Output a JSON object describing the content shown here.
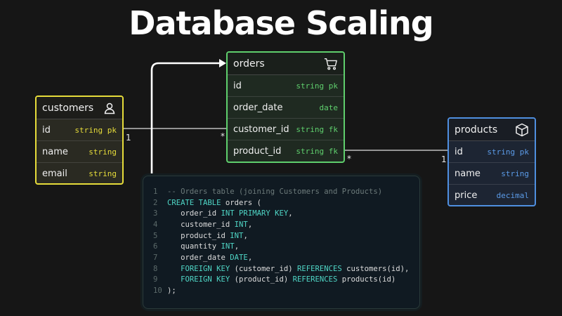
{
  "title": "Database Scaling",
  "colors": {
    "customers": "#e6dc3a",
    "orders": "#5fcf6d",
    "products": "#4f8fe0",
    "keyword": "#4fd6c6"
  },
  "tables": {
    "customers": {
      "name": "customers",
      "icon": "person-icon",
      "rows": [
        {
          "field": "id",
          "type": "string pk"
        },
        {
          "field": "name",
          "type": "string"
        },
        {
          "field": "email",
          "type": "string"
        }
      ]
    },
    "orders": {
      "name": "orders",
      "icon": "cart-icon",
      "rows": [
        {
          "field": "id",
          "type": "string pk"
        },
        {
          "field": "order_date",
          "type": "date"
        },
        {
          "field": "customer_id",
          "type": "string fk"
        },
        {
          "field": "product_id",
          "type": "string fk"
        }
      ]
    },
    "products": {
      "name": "products",
      "icon": "cube-icon",
      "rows": [
        {
          "field": "id",
          "type": "string pk"
        },
        {
          "field": "name",
          "type": "string"
        },
        {
          "field": "price",
          "type": "decimal"
        }
      ]
    }
  },
  "cardinality": {
    "customers_side": "1",
    "orders_customer_side": "*",
    "orders_product_side": "*",
    "products_side": "1"
  },
  "code": {
    "lines": [
      {
        "n": "1",
        "parts": [
          [
            "cm",
            "-- Orders table (joining Customers and Products)"
          ]
        ]
      },
      {
        "n": "2",
        "parts": [
          [
            "kw",
            "CREATE TABLE "
          ],
          [
            "tx",
            "orders ("
          ]
        ]
      },
      {
        "n": "3",
        "parts": [
          [
            "tx",
            "   order_id "
          ],
          [
            "kw",
            "INT PRIMARY KEY"
          ],
          [
            "tx",
            ","
          ]
        ]
      },
      {
        "n": "4",
        "parts": [
          [
            "tx",
            "   customer_id "
          ],
          [
            "kw",
            "INT"
          ],
          [
            "tx",
            ","
          ]
        ]
      },
      {
        "n": "5",
        "parts": [
          [
            "tx",
            "   product_id "
          ],
          [
            "kw",
            "INT"
          ],
          [
            "tx",
            ","
          ]
        ]
      },
      {
        "n": "6",
        "parts": [
          [
            "tx",
            "   quantity "
          ],
          [
            "kw",
            "INT"
          ],
          [
            "tx",
            ","
          ]
        ]
      },
      {
        "n": "7",
        "parts": [
          [
            "tx",
            "   order_date "
          ],
          [
            "kw",
            "DATE"
          ],
          [
            "tx",
            ","
          ]
        ]
      },
      {
        "n": "8",
        "parts": [
          [
            "kw",
            "   FOREIGN KEY "
          ],
          [
            "tx",
            "(customer_id) "
          ],
          [
            "kw",
            "REFERENCES "
          ],
          [
            "tx",
            "customers(id),"
          ]
        ]
      },
      {
        "n": "9",
        "parts": [
          [
            "kw",
            "   FOREIGN KEY "
          ],
          [
            "tx",
            "(product_id) "
          ],
          [
            "kw",
            "REFERENCES "
          ],
          [
            "tx",
            "products(id)"
          ]
        ]
      },
      {
        "n": "10",
        "parts": [
          [
            "tx",
            ");"
          ]
        ]
      }
    ]
  }
}
